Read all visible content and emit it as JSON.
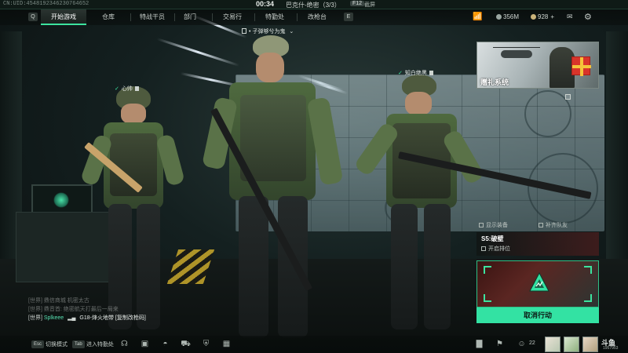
{
  "topbar": {
    "uid": "CN:UID:4548192346230764652",
    "timer": "00:34",
    "map": "巴克什-绝密（3/3）",
    "f12_key": "F12",
    "f12_label": "截屏"
  },
  "nav": {
    "prev_key": "Q",
    "next_key": "E",
    "tabs": [
      {
        "label": "开始游戏",
        "active": true
      },
      {
        "label": "仓库"
      },
      {
        "label": "特战干员"
      },
      {
        "label": "部门"
      },
      {
        "label": "交易行"
      },
      {
        "label": "特勤处"
      },
      {
        "label": "改枪台"
      }
    ],
    "currency_1": "356M",
    "currency_2": "928"
  },
  "mode_selector": "子弹够兮为鬼",
  "players": {
    "left": "心帅",
    "right": "知白绝黑"
  },
  "gift": {
    "label": "赠礼系统"
  },
  "options": {
    "show_gear": "显示装备",
    "team_fill": "补齐队友"
  },
  "season": {
    "title": "S5:破壁",
    "toggle": "开启排位"
  },
  "matchmaking": {
    "cancel_label": "取消行动"
  },
  "chat": {
    "lines": [
      {
        "text": "[世界] 鼎信商城 机密太古",
        "faded": true
      },
      {
        "text": "[世界] 鼎音首: 绝密航天打最后一局来",
        "faded": true
      }
    ],
    "last": {
      "channel": "[世界]",
      "name": "Splkeee",
      "weapon": "G18-烽火地带",
      "link": "[复制改枪码]"
    }
  },
  "bottombar": {
    "mode_key": "Esc",
    "mode_label": "切换模式",
    "lobby_key": "Tab",
    "lobby_label": "进入特勤处",
    "friends": "22",
    "logo": "斗鱼",
    "logo_sub": "1957953"
  },
  "colors": {
    "accent": "#33e2a3",
    "panel": "#0f1a16"
  }
}
